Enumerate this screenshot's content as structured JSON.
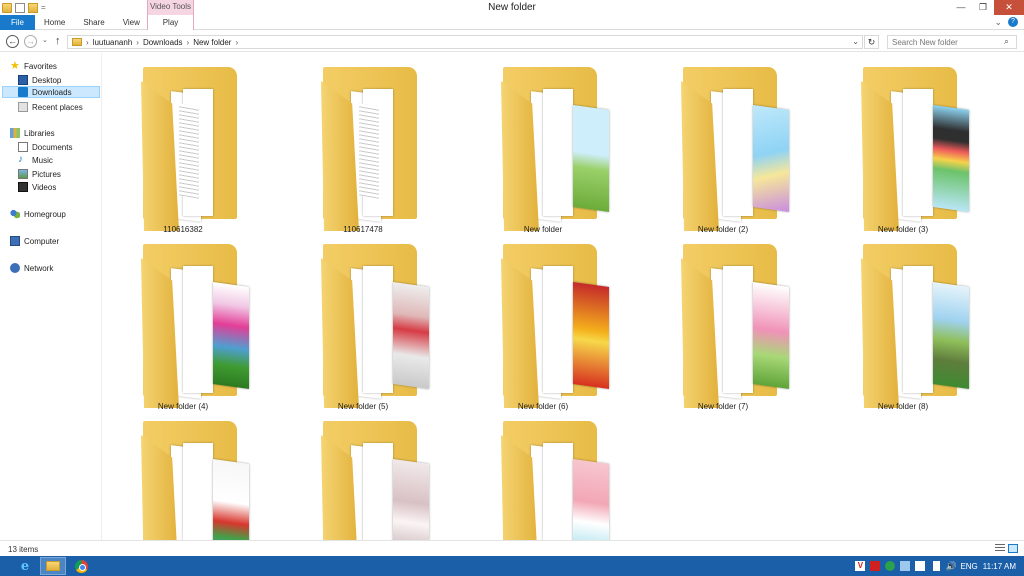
{
  "window": {
    "title": "New folder",
    "context_tab": "Video Tools",
    "controls": {
      "minimize": "—",
      "maximize": "❐",
      "close": "✕"
    }
  },
  "qat": {
    "separator": "="
  },
  "ribbon": {
    "tabs": [
      "File",
      "Home",
      "Share",
      "View",
      "Play"
    ],
    "expand": "⌄",
    "help": "?"
  },
  "address": {
    "back": "←",
    "forward": "→",
    "recent": "⌄",
    "up": "↑",
    "crumbs": [
      "luutuananh",
      "Downloads",
      "New folder"
    ],
    "separator": "›",
    "dropdown": "⌄",
    "refresh": "↻",
    "search_placeholder": "Search New folder",
    "search_icon": "⌕"
  },
  "nav": {
    "favorites": {
      "label": "Favorites",
      "items": [
        "Desktop",
        "Downloads",
        "Recent places"
      ],
      "selected": "Downloads"
    },
    "libraries": {
      "label": "Libraries",
      "items": [
        "Documents",
        "Music",
        "Pictures",
        "Videos"
      ]
    },
    "homegroup": "Homegroup",
    "computer": "Computer",
    "network": "Network"
  },
  "items": [
    {
      "name": "110616382",
      "preview": "document",
      "thumb": ""
    },
    {
      "name": "110617478",
      "preview": "document",
      "thumb": ""
    },
    {
      "name": "New folder",
      "preview": "image",
      "thumb": "linear-gradient(#cfeefc 0%, #cfeefc 45%, #9ad16a 60%, #6cab3a 100%)"
    },
    {
      "name": "New folder (2)",
      "preview": "image",
      "thumb": "linear-gradient(160deg, #bfe9fb 0%, #8fd3f4 45%, #f6e79a 65%, #c98ce0 100%)"
    },
    {
      "name": "New folder (3)",
      "preview": "image",
      "thumb": "linear-gradient(#8cd2f0 0%, #2f2f2f 22%, #2f2f2f 32%, #ef5a5a 42%, #f6d24a 52%, #6cc36a 62%, #b9e6f7 100%)"
    },
    {
      "name": "New folder (4)",
      "preview": "image",
      "thumb": "linear-gradient(#ffffff 0%, #f1c7e4 20%, #e33e97 40%, #4e9fd1 62%, #3f9b31 80%, #2c7a21 100%)"
    },
    {
      "name": "New folder (5)",
      "preview": "image",
      "thumb": "linear-gradient(#eeeeee 0%, #e0b8b8 30%, #d63b44 45%, #e9e9e9 70%, #c9c9c9 100%)"
    },
    {
      "name": "New folder (6)",
      "preview": "image",
      "thumb": "linear-gradient(#c52a2a 0%, #f4b01c 45%, #f7d84a 55%, #d7301f 100%)"
    },
    {
      "name": "New folder (7)",
      "preview": "image",
      "thumb": "linear-gradient(#ffffff 0%, #f7c4d8 25%, #f092b8 45%, #a8d877 70%, #5ea338 100%)"
    },
    {
      "name": "New folder (8)",
      "preview": "image",
      "thumb": "linear-gradient(#e6f4fb 0%, #9fd2ef 35%, #8fbf5a 55%, #5f7d3d 75%, #3e8a31 100%)"
    },
    {
      "name": "",
      "preview": "image",
      "thumb": "linear-gradient(#f7f7f7 0%, #ffffff 40%, #d8372d 60%, #43a047 75%, #4ca0e6 100%)"
    },
    {
      "name": "",
      "preview": "image",
      "thumb": "linear-gradient(#f1e9ea 0%, #d8c1c4 40%, #fbf4f5 60%, #b9a0a5 100%)"
    },
    {
      "name": "",
      "preview": "image",
      "thumb": "linear-gradient(#f7c6cf 0%, #f2a7b5 40%, #ffffff 60%, #89d6e8 100%)"
    }
  ],
  "status": {
    "count": "13 items"
  },
  "taskbar": {
    "ie": "e",
    "tray_badge": "V",
    "volume": "🔊",
    "language": "ENG",
    "clock": "11:17 AM"
  },
  "colors": {
    "file_tab": "#1979ca",
    "context_tab": "#f6d5e2",
    "selection": "#cce8ff",
    "folder": "#e7bb46",
    "taskbar": "#1a5fa8"
  }
}
